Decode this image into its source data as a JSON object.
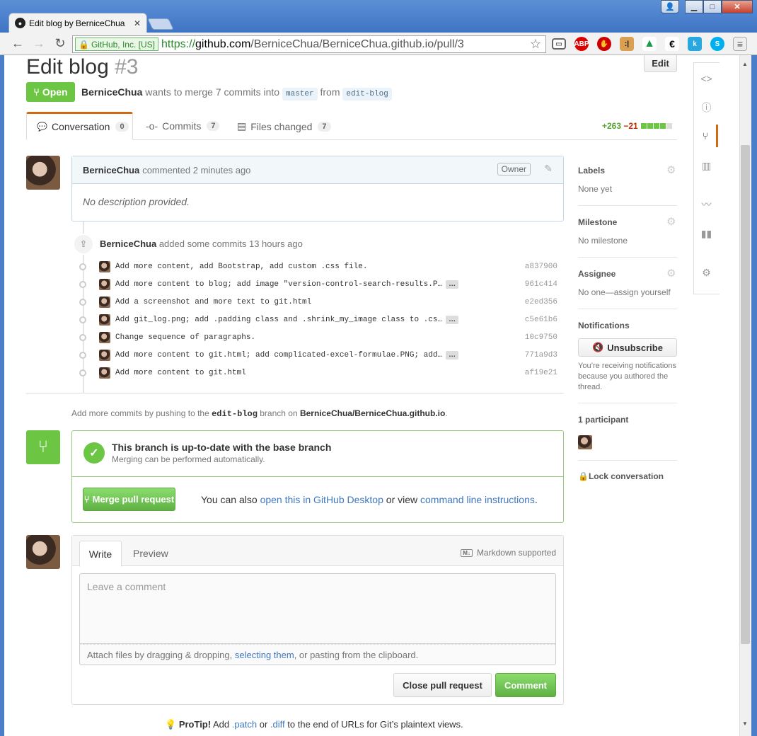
{
  "browser": {
    "tab_title": "Edit blog by BerniceChua",
    "ev_label": "GitHub, Inc. [US]",
    "url_scheme": "https://",
    "url_host": "github.com",
    "url_path": "/BerniceChua/BerniceChua.github.io/pull/3"
  },
  "pr": {
    "title": "Edit blog",
    "number": "#3",
    "edit_label": "Edit",
    "state": "Open",
    "author": "BerniceChua",
    "meta_text": " wants to merge 7 commits into ",
    "base_branch": "master",
    "from_text": " from ",
    "head_branch": "edit-blog"
  },
  "tabs": [
    {
      "label": "Conversation",
      "count": "0"
    },
    {
      "label": "Commits",
      "count": "7"
    },
    {
      "label": "Files changed",
      "count": "7"
    }
  ],
  "diffstat": {
    "additions": "+263",
    "deletions": "−21"
  },
  "comment": {
    "author": "BerniceChua",
    "action": "commented 2 minutes ago",
    "badge": "Owner",
    "body": "No description provided."
  },
  "commits_event": {
    "author": "BerniceChua",
    "text": " added some commits 13 hours ago"
  },
  "commits": [
    {
      "msg": "Add more content, add Bootstrap, add custom .css file.",
      "sha": "a837900",
      "more": false
    },
    {
      "msg": "Add more content to blog; add image \"version-control-search-results.P…",
      "sha": "961c414",
      "more": true
    },
    {
      "msg": "Add a screenshot and more text to git.html",
      "sha": "e2ed356",
      "more": false
    },
    {
      "msg": "Add git_log.png; add .padding class and .shrink_my_image class to .cs…",
      "sha": "c5e61b6",
      "more": true
    },
    {
      "msg": "Change sequence of paragraphs.",
      "sha": "10c9750",
      "more": false
    },
    {
      "msg": "Add more content to git.html; add complicated-excel-formulae.PNG; add…",
      "sha": "771a9d3",
      "more": true
    },
    {
      "msg": "Add more content to git.html",
      "sha": "af19e21",
      "more": false
    }
  ],
  "ellipsis": "…",
  "push_note": {
    "prefix": "Add more commits by pushing to the ",
    "branch": "edit-blog",
    "mid": " branch on ",
    "repo": "BerniceChua/BerniceChua.github.io",
    "suffix": "."
  },
  "merge": {
    "title": "This branch is up-to-date with the base branch",
    "subtitle": "Merging can be performed automatically.",
    "button": "Merge pull request",
    "also_prefix": "You can also ",
    "desktop_link": "open this in GitHub Desktop",
    "or_view": " or view ",
    "cli_link": "command line instructions",
    "suffix": "."
  },
  "new_comment": {
    "write_tab": "Write",
    "preview_tab": "Preview",
    "markdown": "Markdown supported",
    "placeholder": "Leave a comment",
    "attach_prefix": "Attach files by dragging & dropping, ",
    "attach_link": "selecting them",
    "attach_suffix": ", or pasting from the clipboard.",
    "close_button": "Close pull request",
    "comment_button": "Comment"
  },
  "protip": {
    "label": "ProTip!",
    "t1": " Add ",
    "patch": ".patch",
    "t2": " or ",
    "diff": ".diff",
    "t3": " to the end of URLs for Git’s plaintext views."
  },
  "sidebar": {
    "labels_h": "Labels",
    "labels_v": "None yet",
    "milestone_h": "Milestone",
    "milestone_v": "No milestone",
    "assignee_h": "Assignee",
    "assignee_v": "No one—assign yourself",
    "notif_h": "Notifications",
    "unsubscribe": "Unsubscribe",
    "notif_note": "You’re receiving notifications because you authored the thread.",
    "participants_h": "1 participant",
    "lock": "Lock conversation"
  }
}
